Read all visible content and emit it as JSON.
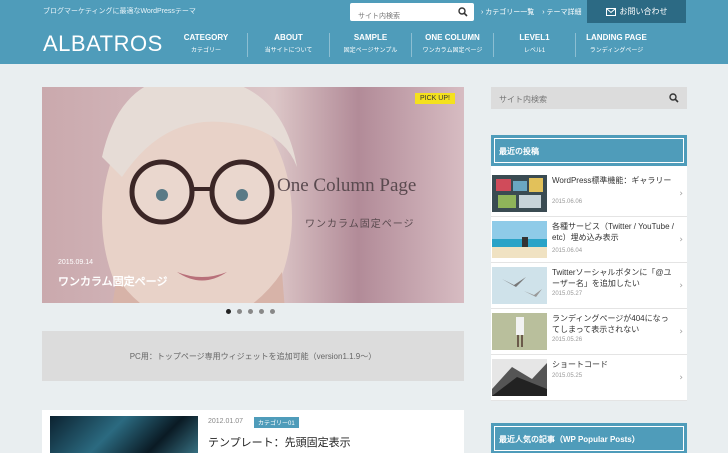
{
  "header": {
    "tagline": "ブログマーケティングに最適なWordPressテーマ",
    "search_placeholder": "サイト内検索",
    "links": [
      "› カテゴリー一覧",
      "› テーマ詳細"
    ],
    "contact": "お問い合わせ",
    "logo": "ALBATROS",
    "nav": [
      {
        "en": "CATEGORY",
        "jp": "カテゴリー"
      },
      {
        "en": "ABOUT",
        "jp": "当サイトについて"
      },
      {
        "en": "SAMPLE",
        "jp": "固定ページサンプル"
      },
      {
        "en": "ONE COLUMN",
        "jp": "ワンカラム固定ページ"
      },
      {
        "en": "LEVEL1",
        "jp": "レベル1"
      },
      {
        "en": "LANDING PAGE",
        "jp": "ランディングページ"
      }
    ],
    "color": "#4f9cba"
  },
  "slider": {
    "badge": "PICK UP!",
    "title": "One Column Page",
    "subtitle": "ワンカラム固定ページ",
    "date": "2015.09.14",
    "caption": "ワンカラム固定ページ",
    "dots": 5,
    "active_dot": 1
  },
  "widget_text": "PC用：トップページ専用ウィジェットを追加可能（version1.1.9〜）",
  "article": {
    "date": "2012.01.07",
    "category": "カテゴリー01",
    "title": "テンプレート：先頭固定表示"
  },
  "sidebar": {
    "search_placeholder": "サイト内検索",
    "recent_title": "最近の投稿",
    "recent": [
      {
        "title": "WordPress標準機能：ギャラリー",
        "date": "2015.06.06"
      },
      {
        "title": "各種サービス（Twitter / YouTube / etc）埋め込み表示",
        "date": "2015.06.04"
      },
      {
        "title": "Twitterソーシャルボタンに「@ユーザー名」を追加したい",
        "date": "2015.05.27"
      },
      {
        "title": "ランディングページが404になってしまって表示されない",
        "date": "2015.05.26"
      },
      {
        "title": "ショートコード",
        "date": "2015.05.25"
      }
    ],
    "popular_title": "最近人気の記事（WP Popular Posts）"
  }
}
